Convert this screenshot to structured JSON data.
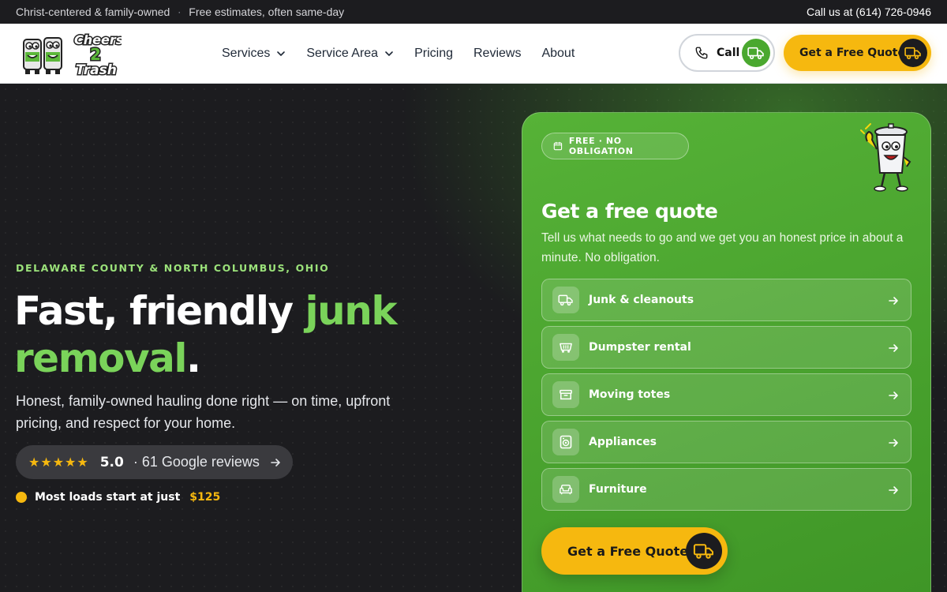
{
  "topbar": {
    "tagline": "Christ-centered & family-owned",
    "separator": "·",
    "estimates": "Free estimates, often same-day",
    "phone_text": "Call us at (614) 726-0946"
  },
  "header": {
    "logo_text": "Cheers 2 Trash",
    "nav": [
      {
        "label": "Services",
        "has_dropdown": true
      },
      {
        "label": "Service Area",
        "has_dropdown": true
      },
      {
        "label": "Pricing",
        "has_dropdown": false
      },
      {
        "label": "Reviews",
        "has_dropdown": false
      },
      {
        "label": "About",
        "has_dropdown": false
      }
    ],
    "call_label": "Call",
    "quote_label": "Get a Free Quote"
  },
  "hero": {
    "eyebrow": "DELAWARE COUNTY & NORTH COLUMBUS, OHIO",
    "headline_part1": "Fast, friendly ",
    "headline_accent": "junk removal",
    "headline_end": ".",
    "subhead": "Honest, family-owned hauling done right — on time, upfront pricing, and respect for your home.",
    "rating": {
      "stars": "★★★★★",
      "score": "5.0",
      "text": "· 61 Google reviews"
    },
    "loads_text": "Most loads start at just",
    "loads_price": "$125"
  },
  "quote_card": {
    "badge": "FREE · NO OBLIGATION",
    "title": "Get a free quote",
    "subtitle": "Tell us what needs to go and we get you an honest price in about a minute. No obligation.",
    "options": [
      {
        "label": "Junk & cleanouts",
        "icon": "truck-icon"
      },
      {
        "label": "Dumpster rental",
        "icon": "dumpster-icon"
      },
      {
        "label": "Moving totes",
        "icon": "tote-icon"
      },
      {
        "label": "Appliances",
        "icon": "appliance-icon"
      },
      {
        "label": "Furniture",
        "icon": "furniture-icon"
      }
    ],
    "cta_label": "Get a Free Quote"
  },
  "colors": {
    "brand_green": "#4aa82f",
    "accent_yellow": "#f6b80f",
    "dark": "#1c1c1f",
    "headline_green": "#7ad35a"
  }
}
